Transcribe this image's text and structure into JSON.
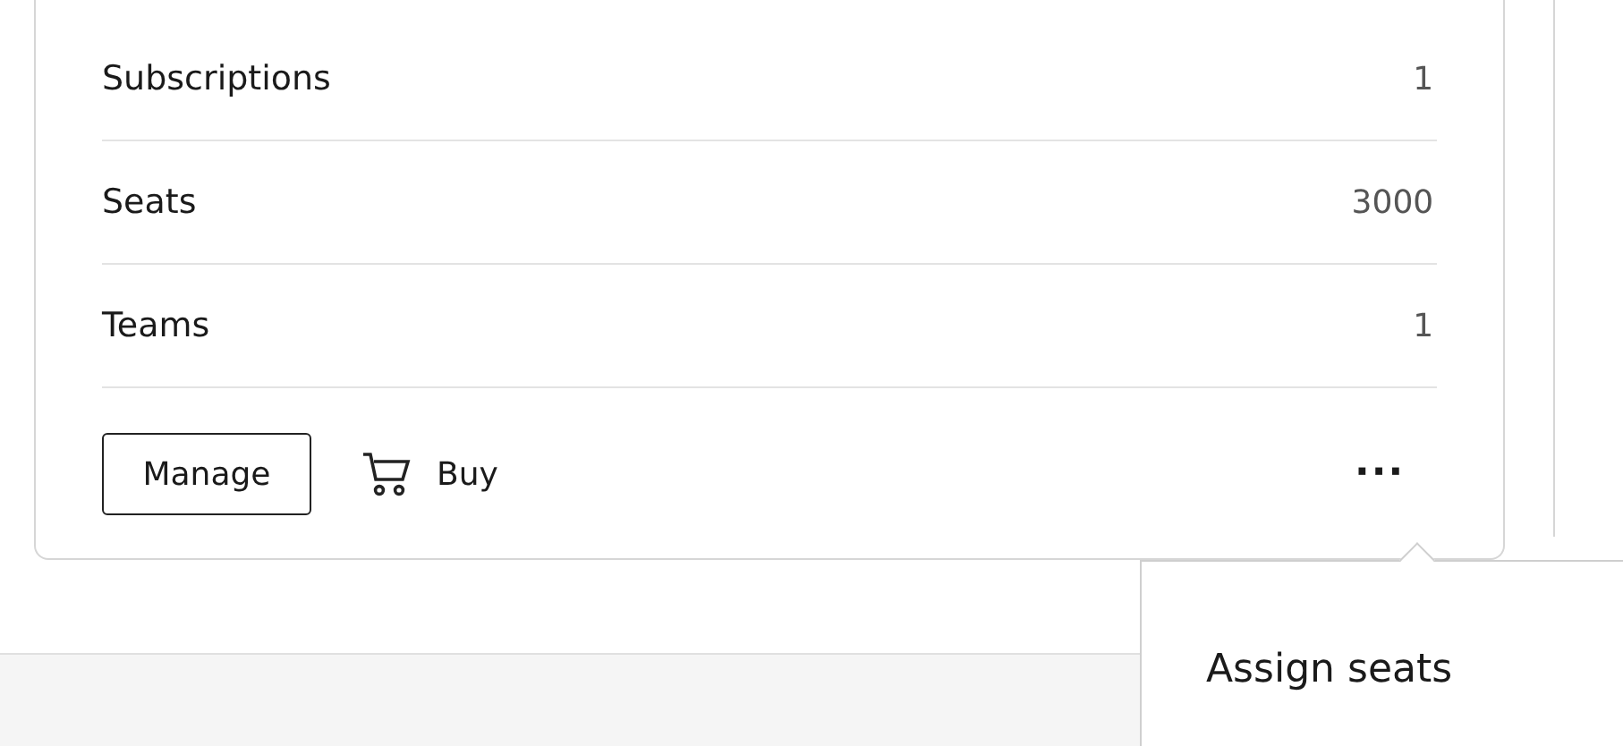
{
  "summary_rows": [
    {
      "label": "Subscriptions",
      "value": "1"
    },
    {
      "label": "Seats",
      "value": "3000"
    },
    {
      "label": "Teams",
      "value": "1"
    }
  ],
  "actions": {
    "manage": "Manage",
    "buy": "Buy",
    "more": "···"
  },
  "more_menu": {
    "expanded": true,
    "items": [
      "Assign seats"
    ]
  }
}
